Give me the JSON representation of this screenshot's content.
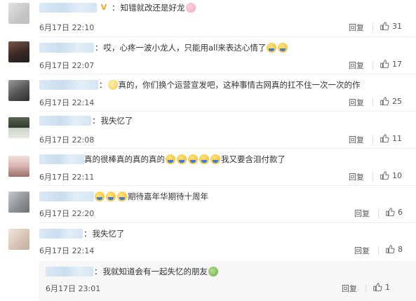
{
  "comments": [
    {
      "text": "知错就改还是好龙",
      "date": "6月17日 22:10",
      "reply": "回复",
      "likes": "31",
      "emojis": [
        "pig-emoji"
      ],
      "colors": [
        "#d8d8d8",
        "#c6c6c6"
      ]
    },
    {
      "text": "哎，心疼一波小龙人，只能用all来表达心情了",
      "date": "6月17日 22:07",
      "reply": "回复",
      "likes": "17",
      "emojis": [
        "doge-emoji",
        "doge-emoji"
      ],
      "colors": [
        "#6b4a3a",
        "#2b2b2b"
      ]
    },
    {
      "text": "真的，你们换个运营宣发吧，这种事情古网真的扛不住一次一次的作",
      "date": "6月17日 22:14",
      "reply": "回复",
      "likes": "25",
      "emojis": [
        "cat-emoji"
      ],
      "colors": [
        "#8a8a8a",
        "#3d3d3d"
      ]
    },
    {
      "text": "我失忆了",
      "date": "6月17日 22:08",
      "reply": "回复",
      "likes": "11",
      "emojis": [],
      "colors": [
        "#3f4a3b",
        "#cfd6cb"
      ]
    },
    {
      "text_before": "真的很棒真的真的真的",
      "text_after": "我又要含泪付款了",
      "date": "6月17日 22:11",
      "reply": "回复",
      "likes": "10",
      "emojis": [
        "doge-emoji",
        "doge-emoji",
        "doge-emoji",
        "doge-emoji",
        "doge-emoji"
      ],
      "colors": [
        "#e3c7c4",
        "#9a6e6b"
      ]
    },
    {
      "text": "期待嘉年华期待十周年",
      "date": "6月17日 22:20",
      "reply": "回复",
      "likes": "6",
      "emojis": [
        "doge-emoji",
        "doge-emoji",
        "doge-emoji"
      ],
      "colors": [
        "#b0b3b8",
        "#7c7f86"
      ]
    },
    {
      "text": "我失忆了",
      "date": "6月17日 22:14",
      "reply": "回复",
      "likes": "8",
      "emojis": [],
      "colors": [
        "#e6d8cf",
        "#cbb7a6"
      ]
    }
  ],
  "sub_comment": {
    "text": "我就知道会有一起失忆的朋友",
    "date": "6月17日 23:01",
    "reply": "回复",
    "likes": "1",
    "emojis": [
      "frog-emoji"
    ]
  },
  "badge_glyph": "V",
  "colon": "："
}
